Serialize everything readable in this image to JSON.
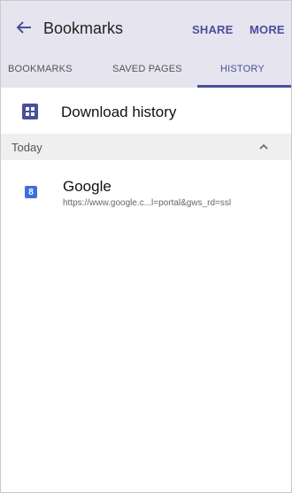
{
  "appbar": {
    "title": "Bookmarks",
    "share_label": "SHARE",
    "more_label": "MORE"
  },
  "tabs": [
    {
      "label": "BOOKMARKS",
      "active": false
    },
    {
      "label": "SAVED PAGES",
      "active": false
    },
    {
      "label": "HISTORY",
      "active": true
    }
  ],
  "download_history": {
    "label": "Download history",
    "icon": "download-grid-icon"
  },
  "section": {
    "label": "Today",
    "state": "expanded"
  },
  "history_items": [
    {
      "title": "Google",
      "url": "https://www.google.c...l=portal&gws_rd=ssl",
      "favicon_glyph": "8"
    }
  ],
  "colors": {
    "accent": "#4a4f9a",
    "header_bg": "#e6e4ee",
    "section_bg": "#efefef",
    "favicon_bg": "#3a6fe0"
  }
}
